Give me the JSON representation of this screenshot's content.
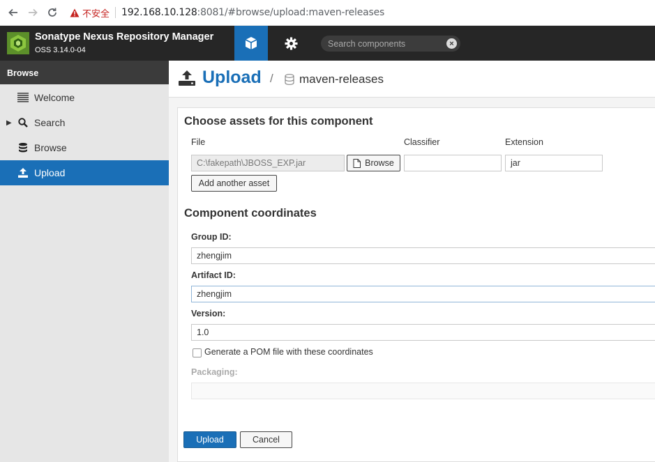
{
  "browser": {
    "warning_label": "不安全",
    "url_host": "192.168.10.128",
    "url_rest": ":8081/#browse/upload:maven-releases"
  },
  "header": {
    "title": "Sonatype Nexus Repository Manager",
    "version": "OSS 3.14.0-04",
    "search_placeholder": "Search components"
  },
  "sidebar": {
    "heading": "Browse",
    "items": [
      {
        "label": "Welcome",
        "icon": "list-icon"
      },
      {
        "label": "Search",
        "icon": "search-icon"
      },
      {
        "label": "Browse",
        "icon": "database-icon"
      },
      {
        "label": "Upload",
        "icon": "upload-icon",
        "active": true
      }
    ]
  },
  "page": {
    "title": "Upload",
    "separator": "/",
    "repository": "maven-releases"
  },
  "assets": {
    "heading": "Choose assets for this component",
    "file_label": "File",
    "classifier_label": "Classifier",
    "extension_label": "Extension",
    "file_value": "C:\\fakepath\\JBOSS_EXP.jar",
    "browse_label": "Browse",
    "classifier_value": "",
    "extension_value": "jar",
    "add_asset_label": "Add another asset"
  },
  "coordinates": {
    "heading": "Component coordinates",
    "group_label": "Group ID:",
    "group_value": "zhengjim",
    "artifact_label": "Artifact ID:",
    "artifact_value": "zhengjim",
    "version_label": "Version:",
    "version_value": "1.0",
    "pom_label": "Generate a POM file with these coordinates",
    "packaging_label": "Packaging:",
    "packaging_value": ""
  },
  "actions": {
    "upload_label": "Upload",
    "cancel_label": "Cancel"
  },
  "colors": {
    "accent": "#1a6fb7",
    "header_bg": "#262626",
    "warning": "#c5221f"
  }
}
